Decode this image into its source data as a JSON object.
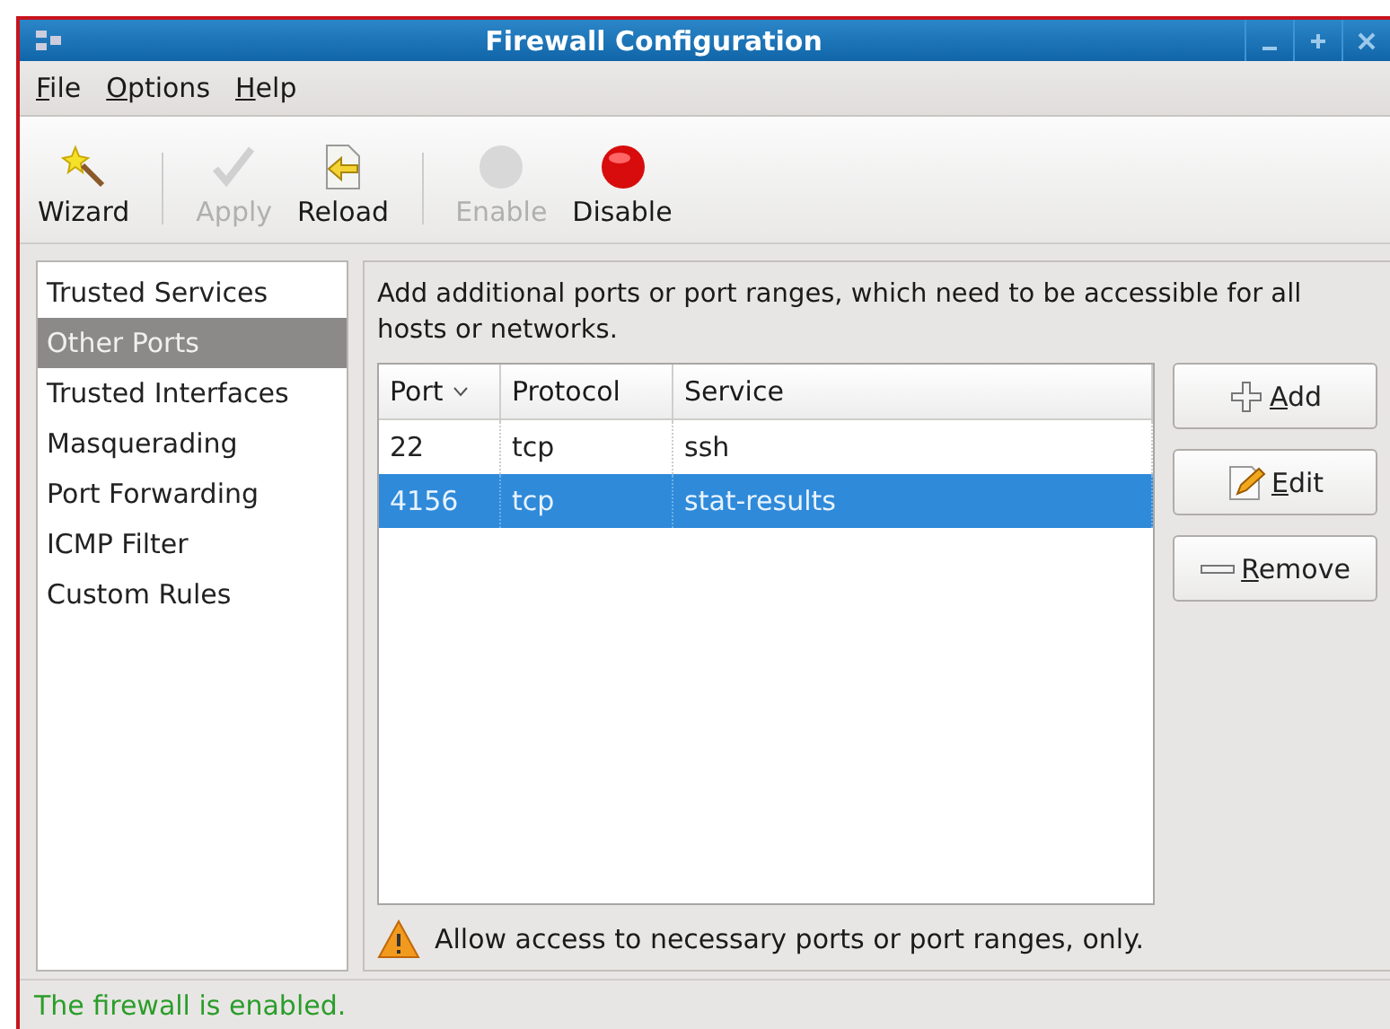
{
  "window": {
    "title": "Firewall Configuration"
  },
  "menu": [
    {
      "label": "File",
      "mnemonic": true
    },
    {
      "label": "Options",
      "mnemonic": true
    },
    {
      "label": "Help",
      "mnemonic": true
    }
  ],
  "toolbar": [
    {
      "kind": "wizard",
      "label": "Wizard",
      "disabled": false
    },
    {
      "kind": "separator"
    },
    {
      "kind": "apply",
      "label": "Apply",
      "disabled": true
    },
    {
      "kind": "reload",
      "label": "Reload",
      "disabled": false
    },
    {
      "kind": "separator"
    },
    {
      "kind": "enable",
      "label": "Enable",
      "disabled": true
    },
    {
      "kind": "disable",
      "label": "Disable",
      "disabled": false
    }
  ],
  "sidebar": {
    "items": [
      {
        "label": "Trusted Services",
        "selected": false
      },
      {
        "label": "Other Ports",
        "selected": true
      },
      {
        "label": "Trusted Interfaces",
        "selected": false
      },
      {
        "label": "Masquerading",
        "selected": false
      },
      {
        "label": "Port Forwarding",
        "selected": false
      },
      {
        "label": "ICMP Filter",
        "selected": false
      },
      {
        "label": "Custom Rules",
        "selected": false
      }
    ]
  },
  "description": "Add additional ports or port ranges, which need to be accessible for all hosts or networks.",
  "table": {
    "columns": [
      {
        "label": "Port",
        "sorted": true
      },
      {
        "label": "Protocol",
        "sorted": false
      },
      {
        "label": "Service",
        "sorted": false
      }
    ],
    "rows": [
      {
        "cells": [
          "22",
          "tcp",
          "ssh"
        ],
        "selected": false
      },
      {
        "cells": [
          "4156",
          "tcp",
          "stat-results"
        ],
        "selected": true
      }
    ]
  },
  "buttons": [
    {
      "kind": "add",
      "label": "Add",
      "mnemonic": true
    },
    {
      "kind": "edit",
      "label": "Edit",
      "mnemonic": true
    },
    {
      "kind": "remove",
      "label": "Remove",
      "mnemonic": true
    }
  ],
  "warning": "Allow access to necessary ports or port ranges, only.",
  "status_bar": "The firewall is enabled."
}
